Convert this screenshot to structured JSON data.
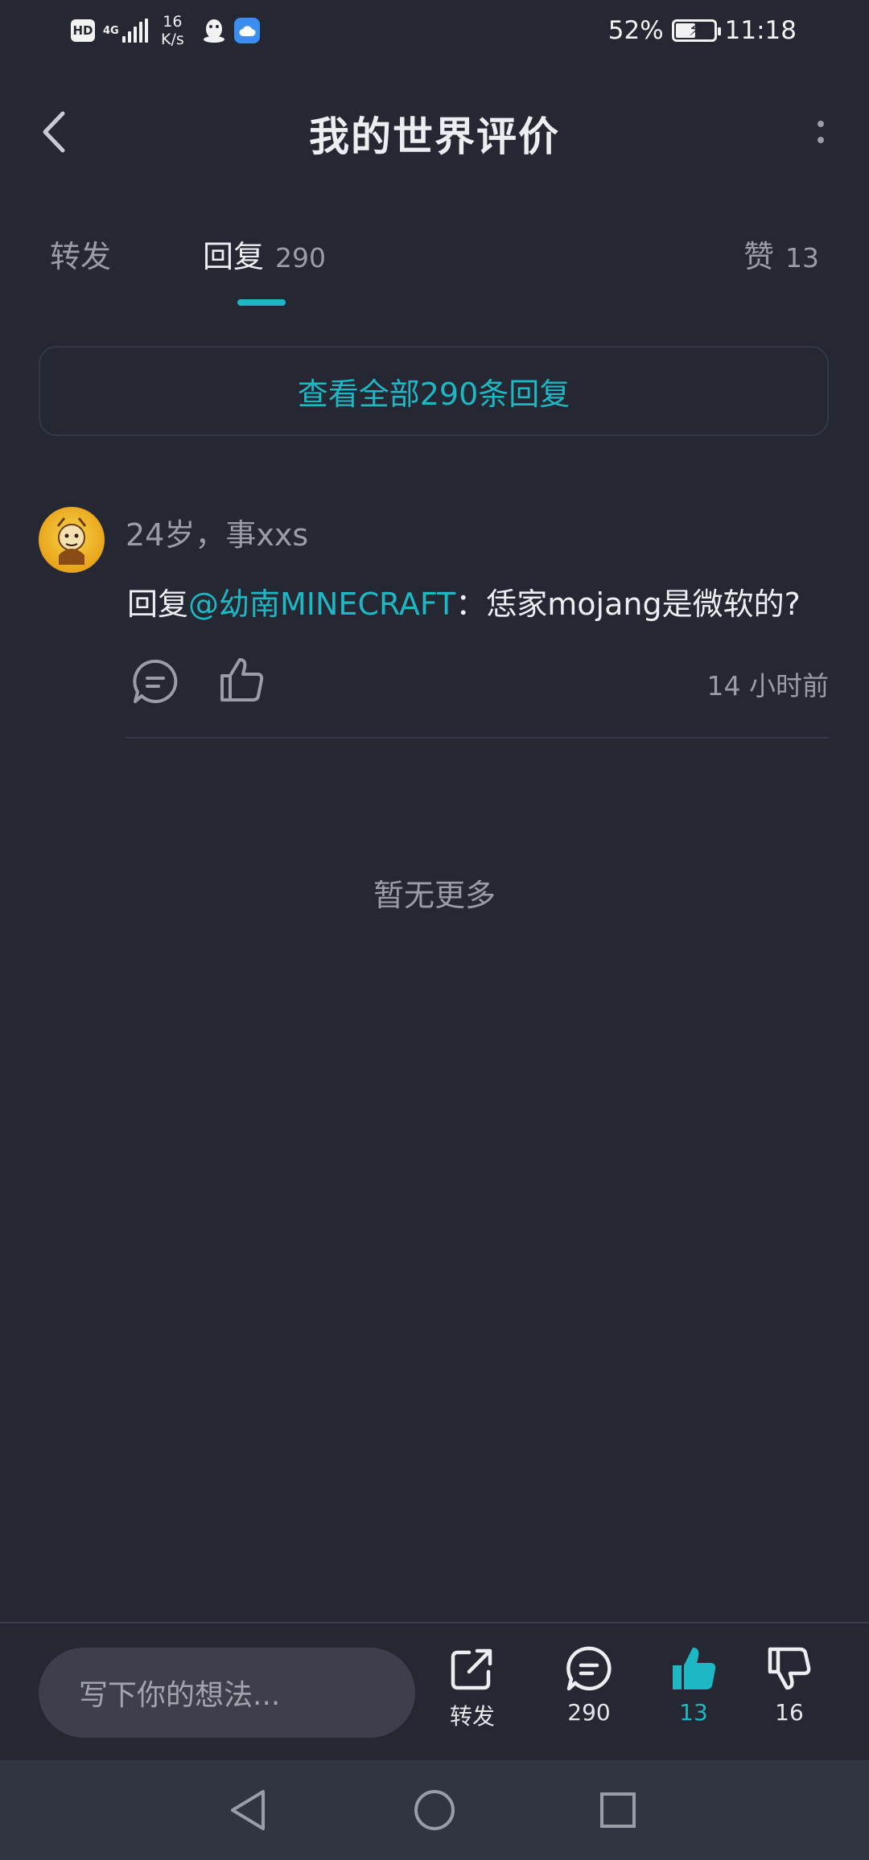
{
  "status_bar": {
    "hd": "HD",
    "network": "4G",
    "speed_value": "16",
    "speed_unit": "K/s",
    "battery": "52%",
    "battery_level": 0.52,
    "time": "11:18"
  },
  "header": {
    "title": "我的世界评价"
  },
  "tabs": {
    "forward_label": "转发",
    "reply_label": "回复",
    "reply_count": "290",
    "like_label": "赞",
    "like_count": "13",
    "active": "reply"
  },
  "view_all": "查看全部290条回复",
  "reply": {
    "username": "24岁，事xxs",
    "prefix": "回复",
    "mention": "@幼南MINECRAFT",
    "body": "：恁家mojang是微软的?",
    "time": "14 小时前"
  },
  "no_more": "暂无更多",
  "bottom_bar": {
    "input_placeholder": "写下你的想法...",
    "forward_label": "转发",
    "comments_count": "290",
    "likes_count": "13",
    "dislikes_count": "16"
  },
  "colors": {
    "accent": "#1db8c4",
    "background": "#252733",
    "muted_text": "#9a9ca6"
  }
}
